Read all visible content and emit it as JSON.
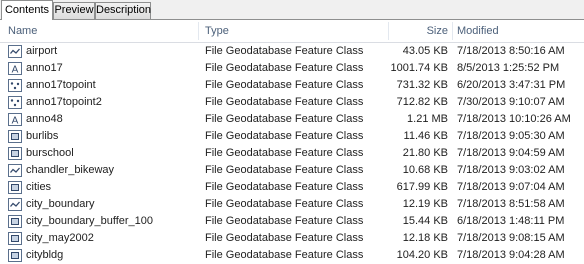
{
  "tabs": [
    {
      "label": "Contents",
      "active": true
    },
    {
      "label": "Preview",
      "active": false
    },
    {
      "label": "Description",
      "active": false
    }
  ],
  "columns": {
    "name": "Name",
    "type": "Type",
    "size": "Size",
    "modified": "Modified"
  },
  "rows": [
    {
      "icon": "line-feature-class-icon",
      "name": "airport",
      "type": "File Geodatabase Feature Class",
      "size": "43.05 KB",
      "modified": "7/18/2013 8:50:16 AM"
    },
    {
      "icon": "annotation-feature-class-icon",
      "name": "anno17",
      "type": "File Geodatabase Feature Class",
      "size": "1001.74 KB",
      "modified": "8/5/2013 1:25:52 PM"
    },
    {
      "icon": "point-feature-class-icon",
      "name": "anno17topoint",
      "type": "File Geodatabase Feature Class",
      "size": "731.32 KB",
      "modified": "6/20/2013 3:47:31 PM"
    },
    {
      "icon": "point-feature-class-icon",
      "name": "anno17topoint2",
      "type": "File Geodatabase Feature Class",
      "size": "712.82 KB",
      "modified": "7/30/2013 9:10:07 AM"
    },
    {
      "icon": "annotation-feature-class-icon",
      "name": "anno48",
      "type": "File Geodatabase Feature Class",
      "size": "1.21 MB",
      "modified": "7/18/2013 10:10:26 AM"
    },
    {
      "icon": "polygon-feature-class-icon",
      "name": "burlibs",
      "type": "File Geodatabase Feature Class",
      "size": "11.46 KB",
      "modified": "7/18/2013 9:05:30 AM"
    },
    {
      "icon": "polygon-feature-class-icon",
      "name": "burschool",
      "type": "File Geodatabase Feature Class",
      "size": "21.80 KB",
      "modified": "7/18/2013 9:04:59 AM"
    },
    {
      "icon": "line-feature-class-icon",
      "name": "chandler_bikeway",
      "type": "File Geodatabase Feature Class",
      "size": "10.68 KB",
      "modified": "7/18/2013 9:03:02 AM"
    },
    {
      "icon": "polygon-feature-class-icon",
      "name": "cities",
      "type": "File Geodatabase Feature Class",
      "size": "617.99 KB",
      "modified": "7/18/2013 9:07:04 AM"
    },
    {
      "icon": "line-feature-class-icon",
      "name": "city_boundary",
      "type": "File Geodatabase Feature Class",
      "size": "12.19 KB",
      "modified": "7/18/2013 8:51:58 AM"
    },
    {
      "icon": "polygon-feature-class-icon",
      "name": "city_boundary_buffer_100",
      "type": "File Geodatabase Feature Class",
      "size": "15.44 KB",
      "modified": "6/18/2013 1:48:11 PM"
    },
    {
      "icon": "polygon-feature-class-icon",
      "name": "city_may2002",
      "type": "File Geodatabase Feature Class",
      "size": "12.18 KB",
      "modified": "7/18/2013 9:08:15 AM"
    },
    {
      "icon": "polygon-feature-class-icon",
      "name": "citybldg",
      "type": "File Geodatabase Feature Class",
      "size": "104.20 KB",
      "modified": "7/18/2013 9:04:28 AM"
    }
  ]
}
